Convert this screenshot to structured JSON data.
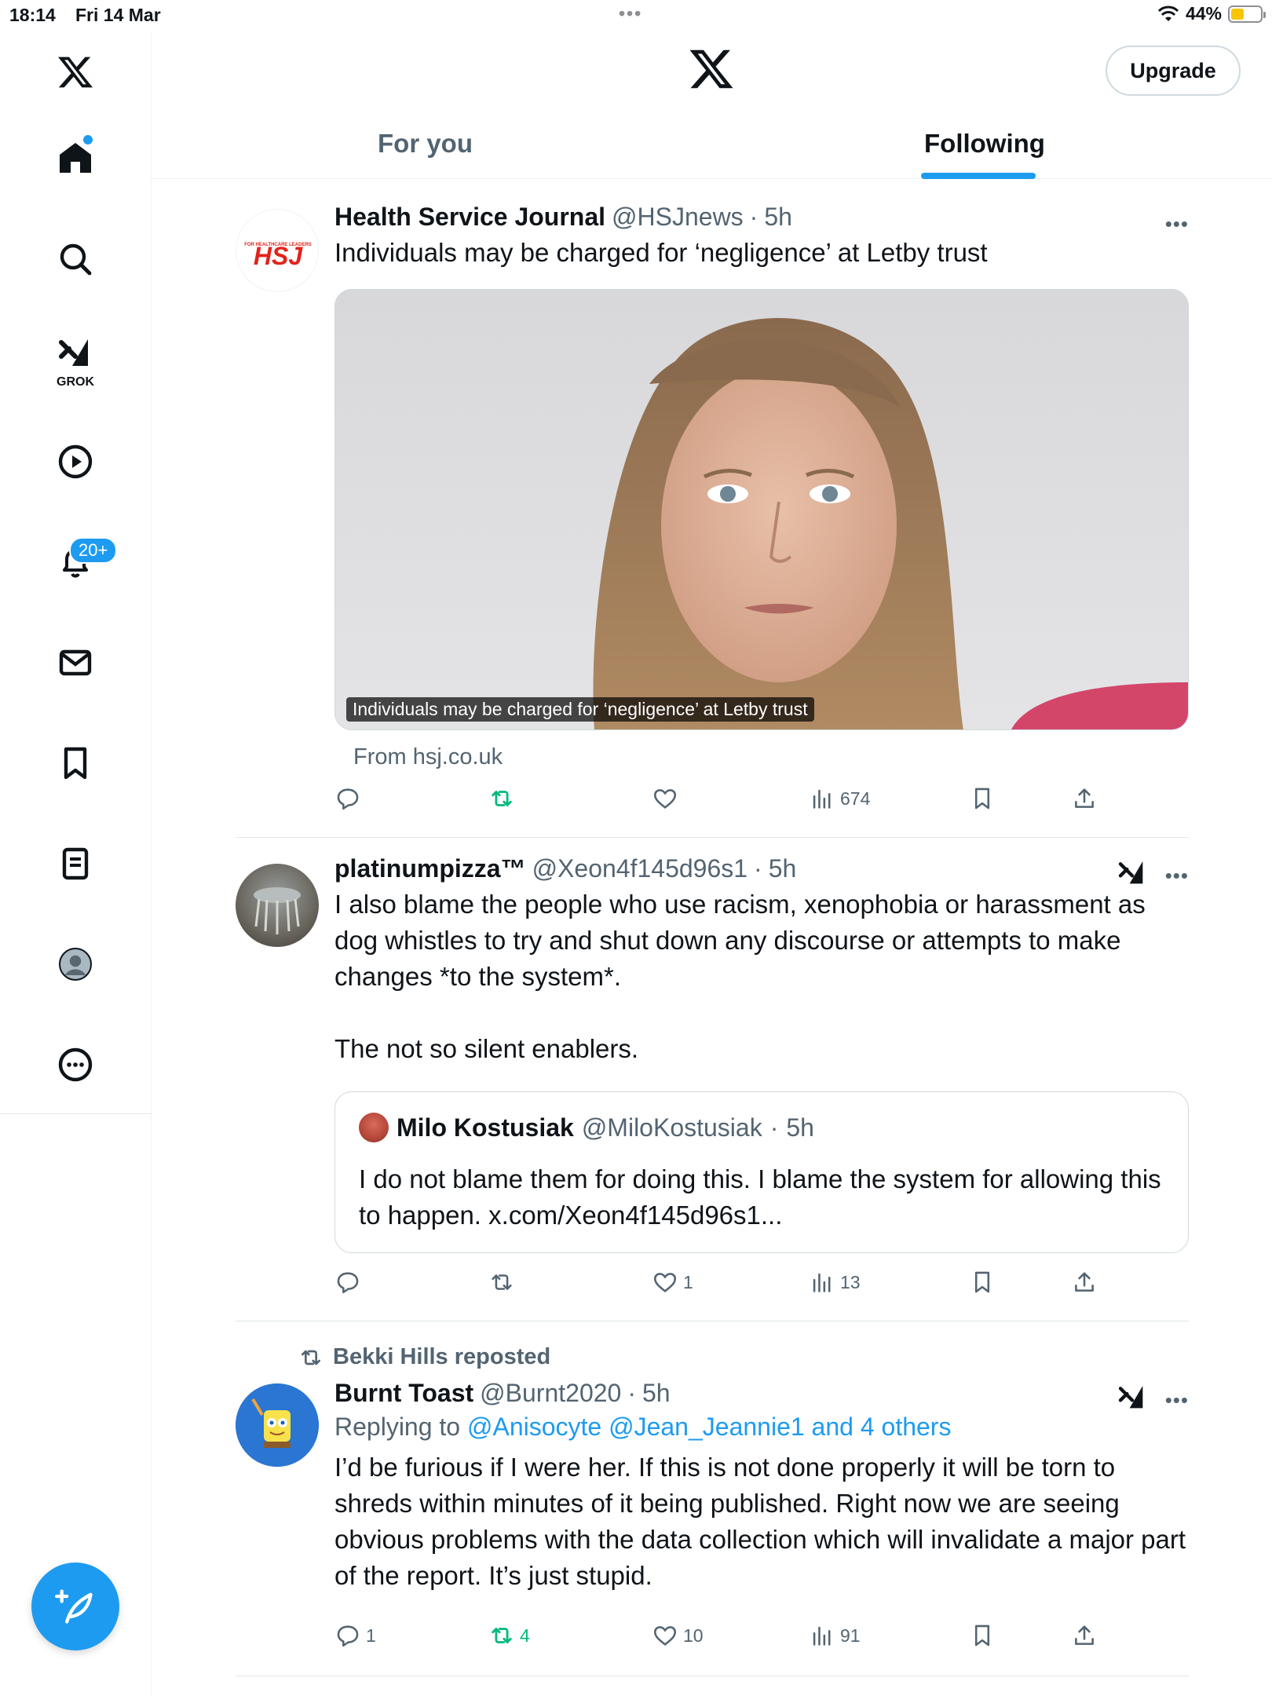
{
  "status_bar": {
    "time": "18:14",
    "date": "Fri 14 Mar",
    "battery": "44%",
    "battery_level": 0.44
  },
  "header": {
    "upgrade_label": "Upgrade"
  },
  "nav": {
    "grok_label": "GROK",
    "notifications_badge": "20+"
  },
  "tabs": [
    {
      "label": "For you",
      "active": false
    },
    {
      "label": "Following",
      "active": true
    }
  ],
  "tweets": [
    {
      "name": "Health Service Journal",
      "handle": "@HSJnews",
      "time": "5h",
      "text": "Individuals may be charged for ‘negligence’ at Letby trust",
      "avatar_text": "HSJ",
      "avatar_small_text": "FOR HEALTHCARE LEADERS",
      "media_caption": "Individuals may be charged for ‘negligence’ at Letby trust",
      "link_source": "From hsj.co.uk",
      "replies": "",
      "reposts": "",
      "likes": "",
      "views": "674"
    },
    {
      "name": "platinumpizza™",
      "handle": "@Xeon4f145d96s1",
      "time": "5h",
      "text": "I also blame the people who use racism, xenophobia or harassment as dog whistles to try and shut down any discourse or attempts to make changes *to the system*.\n\nThe not so silent enablers.",
      "quote": {
        "name": "Milo Kostusiak",
        "handle": "@MiloKostusiak",
        "time": "5h",
        "text": "I do not blame them for doing this. I blame the system for allowing this to happen. x.com/Xeon4f145d96s1..."
      },
      "replies": "",
      "reposts": "",
      "likes": "1",
      "views": "13"
    },
    {
      "reposted_by": "Bekki Hills reposted",
      "name": "Burnt Toast",
      "handle": "@Burnt2020",
      "time": "5h",
      "replying_prefix": "Replying to",
      "replying_to": "@Anisocyte @Jean_Jeannie1 and 4 others",
      "text": "I’d be furious if I were her. If this is not done properly it will be torn to shreds within minutes of it being published. Right now we are seeing obvious problems with the data collection which will invalidate a major part of the report. It’s just stupid.",
      "replies": "1",
      "reposts": "4",
      "likes": "10",
      "views": "91"
    }
  ],
  "colors": {
    "accent": "#1d9bf0",
    "repost_green": "#00ba7c",
    "secondary_text": "#536471",
    "hsj_red": "#e2231a"
  }
}
